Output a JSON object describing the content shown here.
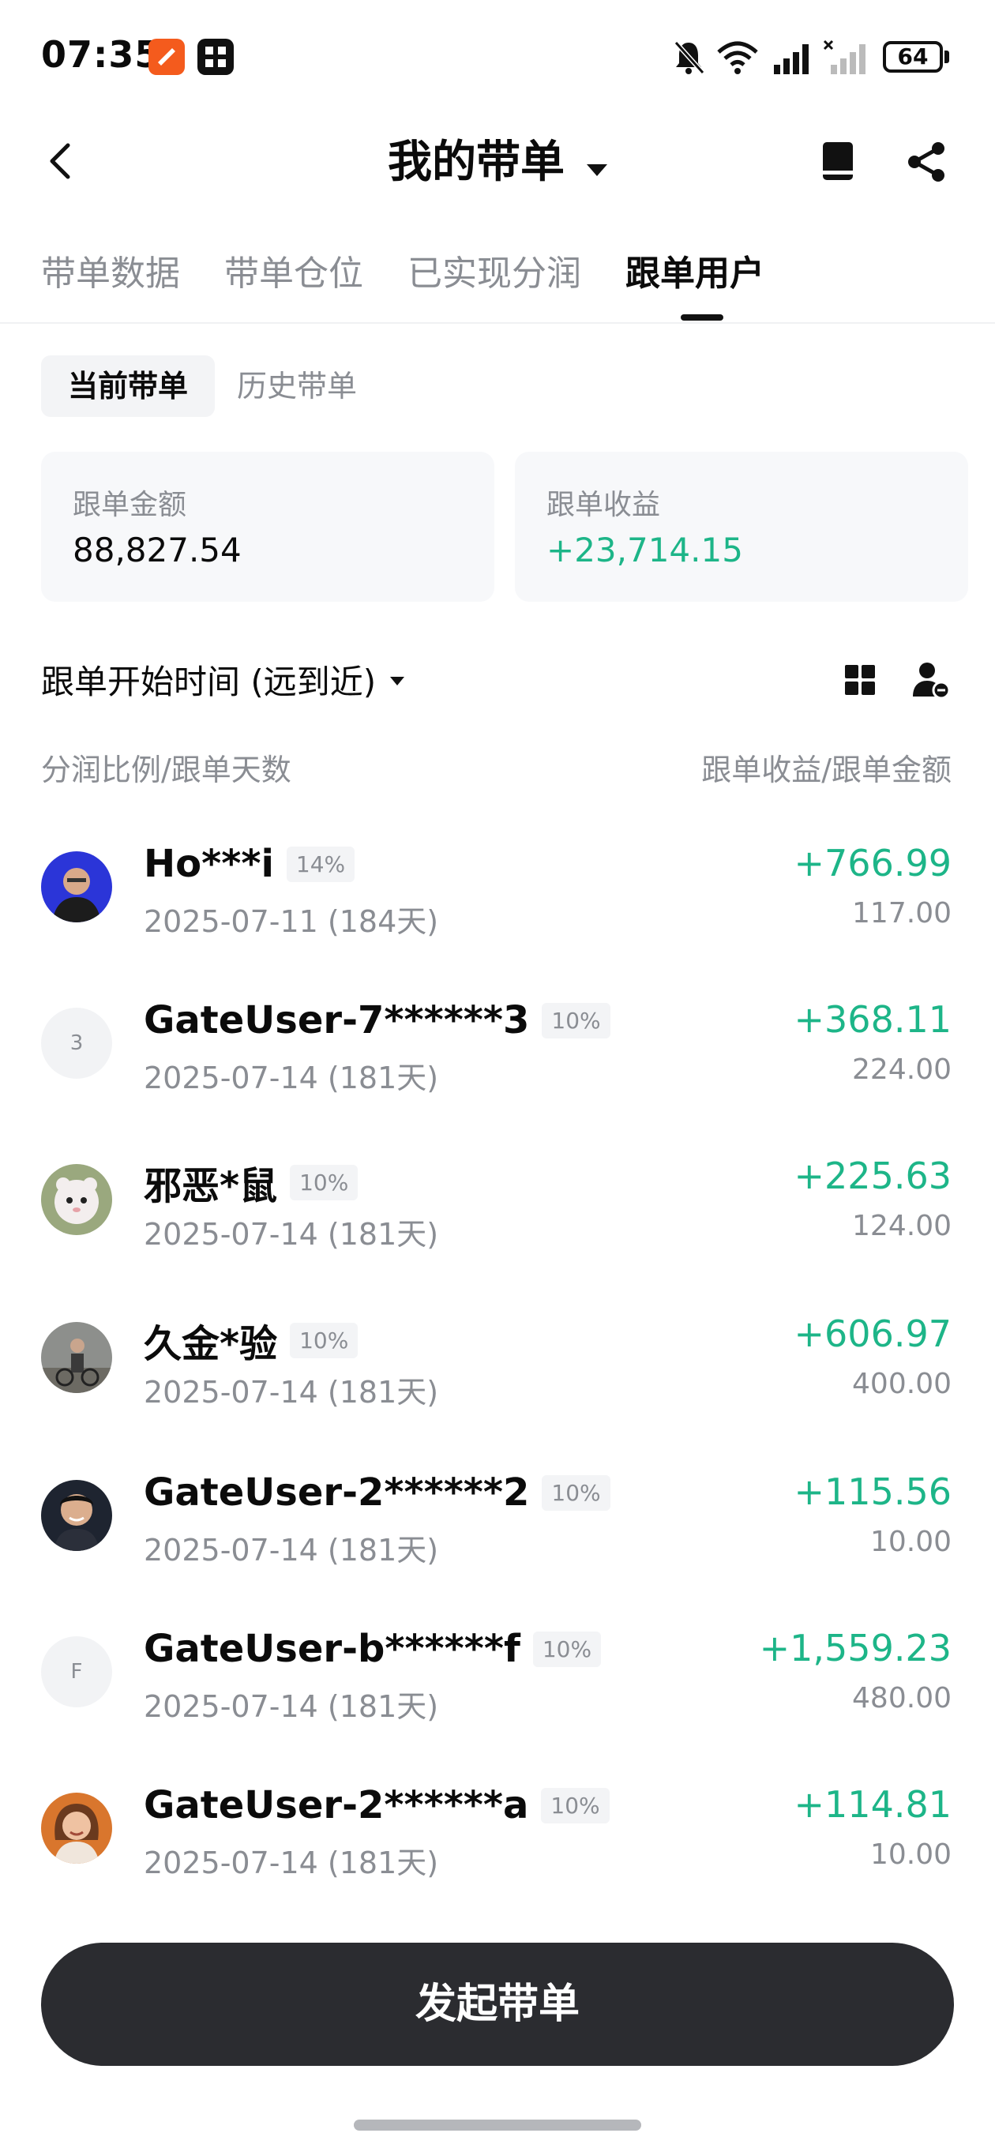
{
  "status_bar": {
    "time": "07:35",
    "battery": "64",
    "icons": [
      "app-icon-orange",
      "app-icon-grid",
      "mute-bell-icon",
      "wifi-icon",
      "signal-icon",
      "signal-off-icon",
      "battery-icon"
    ]
  },
  "header": {
    "title": "我的带单",
    "icons": [
      "back-arrow-icon",
      "dropdown-caret-icon",
      "book-icon",
      "share-icon"
    ]
  },
  "tabs": [
    {
      "label": "带单数据",
      "active": false
    },
    {
      "label": "带单仓位",
      "active": false
    },
    {
      "label": "已实现分润",
      "active": false
    },
    {
      "label": "跟单用户",
      "active": true
    }
  ],
  "subtabs": {
    "current": "当前带单",
    "history": "历史带单"
  },
  "summary": {
    "amount_label": "跟单金额",
    "amount_value": "88,827.54",
    "profit_label": "跟单收益",
    "profit_value": "+23,714.15"
  },
  "sort": {
    "label": "跟单开始时间 (远到近)",
    "icons": [
      "grid-view-icon",
      "person-filter-icon"
    ]
  },
  "columns": {
    "left": "分润比例/跟单天数",
    "right": "跟单收益/跟单金额"
  },
  "followers": [
    {
      "name": "Ho***i",
      "ratio": "14%",
      "date": "2025-07-11 (184天)",
      "profit": "+766.99",
      "amount": "117.00",
      "avatar": "photo",
      "avatar_text": ""
    },
    {
      "name": "GateUser-7******3",
      "ratio": "10%",
      "date": "2025-07-14 (181天)",
      "profit": "+368.11",
      "amount": "224.00",
      "avatar": "letter",
      "avatar_text": "3"
    },
    {
      "name": "邪恶*鼠",
      "ratio": "10%",
      "date": "2025-07-14 (181天)",
      "profit": "+225.63",
      "amount": "124.00",
      "avatar": "photo",
      "avatar_text": ""
    },
    {
      "name": "久金*验",
      "ratio": "10%",
      "date": "2025-07-14 (181天)",
      "profit": "+606.97",
      "amount": "400.00",
      "avatar": "photo",
      "avatar_text": ""
    },
    {
      "name": "GateUser-2******2",
      "ratio": "10%",
      "date": "2025-07-14 (181天)",
      "profit": "+115.56",
      "amount": "10.00",
      "avatar": "photo",
      "avatar_text": ""
    },
    {
      "name": "GateUser-b******f",
      "ratio": "10%",
      "date": "2025-07-14 (181天)",
      "profit": "+1,559.23",
      "amount": "480.00",
      "avatar": "letter",
      "avatar_text": "F"
    },
    {
      "name": "GateUser-2******a",
      "ratio": "10%",
      "date": "2025-07-14 (181天)",
      "profit": "+114.81",
      "amount": "10.00",
      "avatar": "photo",
      "avatar_text": ""
    }
  ],
  "cta": {
    "label": "发起带单"
  },
  "colors": {
    "positive": "#1db588",
    "muted": "#8a8d93",
    "cta_bg": "#2b2c30"
  }
}
